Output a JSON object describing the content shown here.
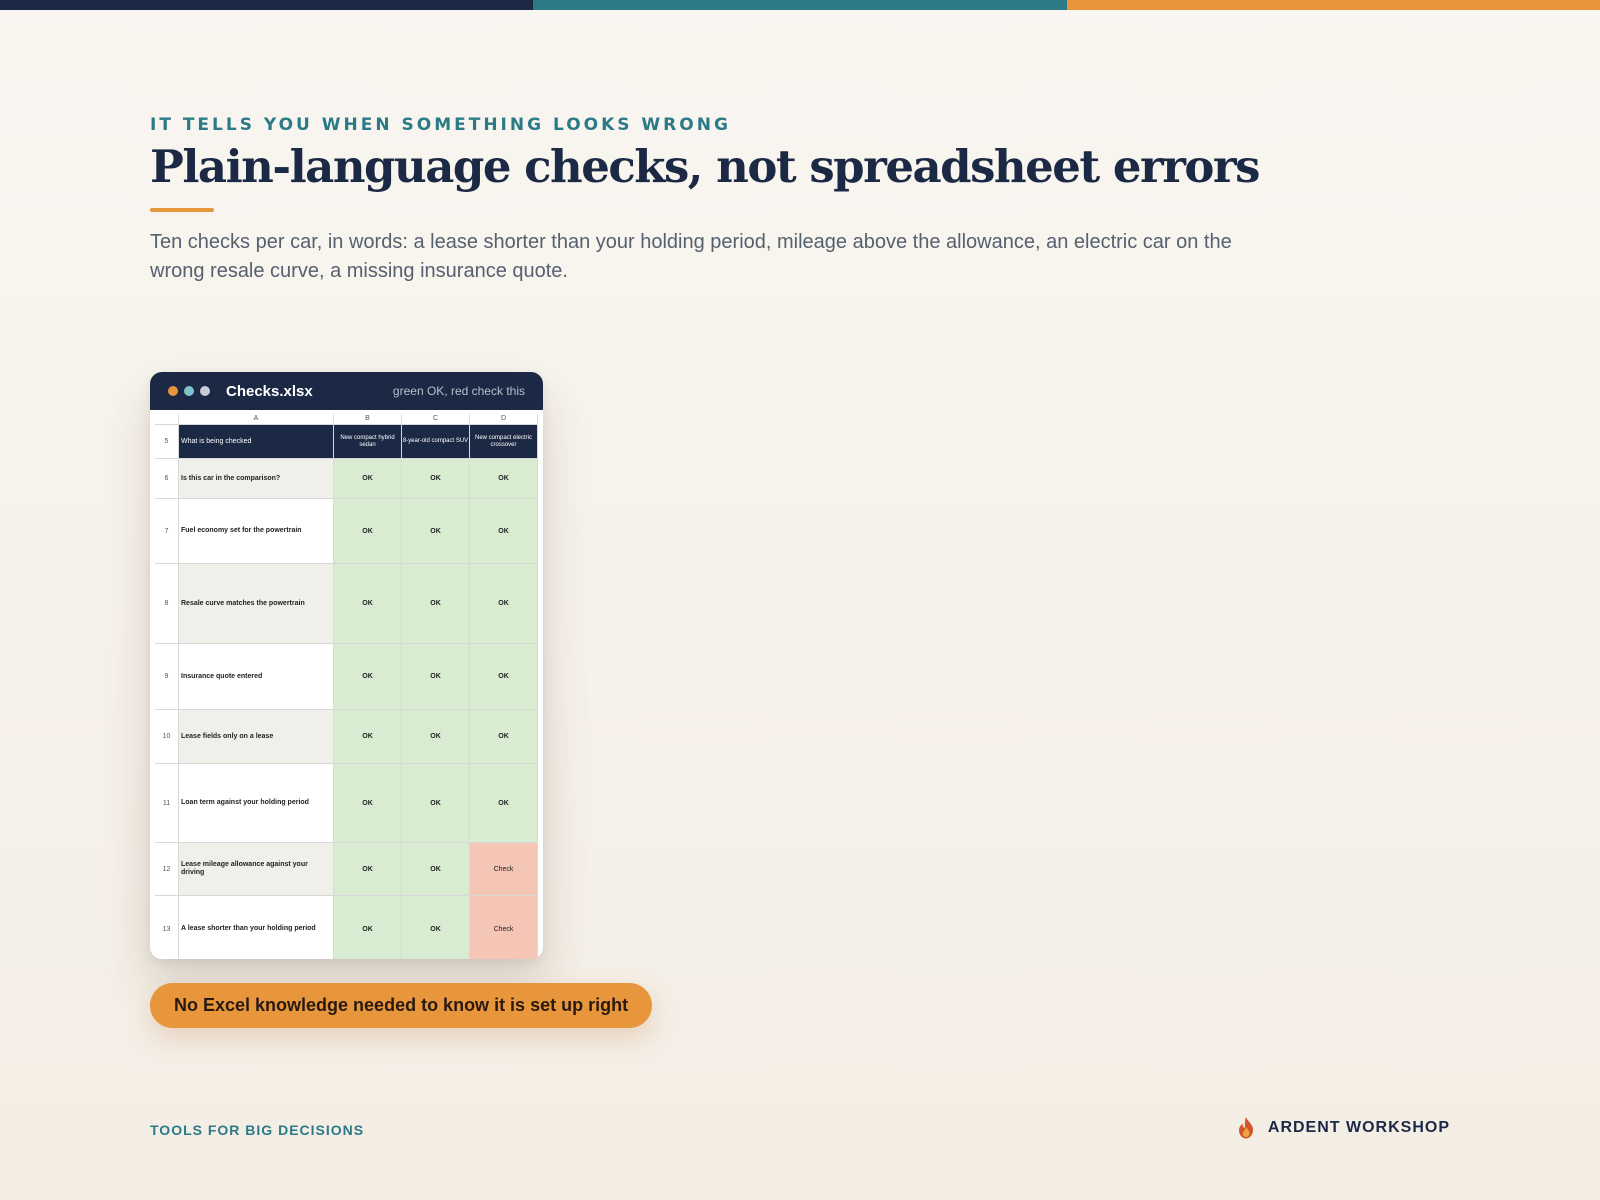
{
  "colors": {
    "navy": "#1c2945",
    "teal": "#2b7a86",
    "orange": "#e8963c",
    "ok_green": "#d8ecd2",
    "check_red": "#f5c6b6"
  },
  "eyebrow": "IT TELLS YOU WHEN SOMETHING LOOKS WRONG",
  "title": "Plain-language checks, not spreadsheet errors",
  "description": "Ten checks per car, in words: a lease shorter than your holding period, mileage above the allowance, an electric car on the wrong resale curve, a missing insurance quote.",
  "sheet": {
    "window_title": "Checks.xlsx",
    "legend": "green OK, red check this",
    "columns": [
      "A",
      "B",
      "C",
      "D"
    ],
    "header": {
      "row": "5",
      "label": "What is being checked",
      "cars": [
        "New compact hybrid sedan",
        "8-year-old compact SUV",
        "New compact electric crossover"
      ]
    },
    "rows": [
      {
        "row": "6",
        "label": "Is this car in the comparison?",
        "values": [
          "OK",
          "OK",
          "OK"
        ]
      },
      {
        "row": "7",
        "label": "Fuel economy set for the powertrain",
        "values": [
          "OK",
          "OK",
          "OK"
        ]
      },
      {
        "row": "8",
        "label": "Resale curve matches the powertrain",
        "values": [
          "OK",
          "OK",
          "OK"
        ]
      },
      {
        "row": "9",
        "label": "Insurance quote entered",
        "values": [
          "OK",
          "OK",
          "OK"
        ]
      },
      {
        "row": "10",
        "label": "Lease fields only on a lease",
        "values": [
          "OK",
          "OK",
          "OK"
        ]
      },
      {
        "row": "11",
        "label": "Loan term against your holding period",
        "values": [
          "OK",
          "OK",
          "OK"
        ]
      },
      {
        "row": "12",
        "label": "Lease mileage allowance against your driving",
        "values": [
          "OK",
          "OK",
          "Check"
        ]
      },
      {
        "row": "13",
        "label": "A lease shorter than your holding period",
        "values": [
          "OK",
          "OK",
          "Check"
        ]
      }
    ]
  },
  "pill": "No Excel knowledge needed to know it is set up right",
  "footer": {
    "tagline": "TOOLS FOR BIG DECISIONS",
    "brand": "ARDENT WORKSHOP",
    "brand_icon": "flame-icon"
  }
}
